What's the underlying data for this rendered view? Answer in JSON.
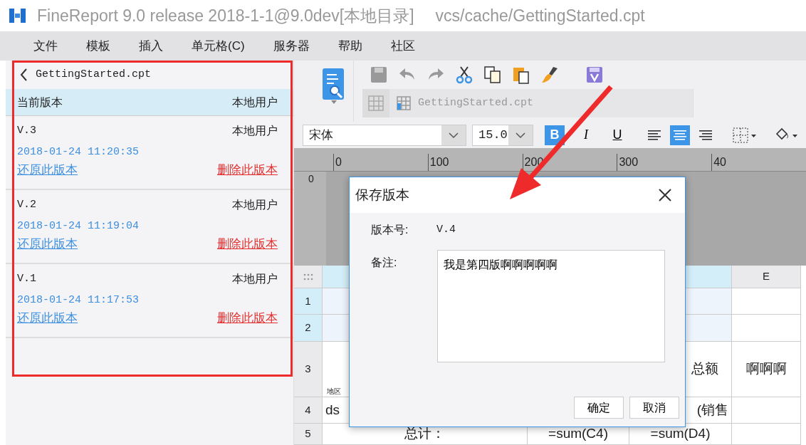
{
  "window": {
    "title": "FineReport 9.0 release 2018-1-1@9.0dev[本地目录]",
    "path": "vcs/cache/GettingStarted.cpt"
  },
  "menu": [
    "文件",
    "模板",
    "插入",
    "单元格(C)",
    "服务器",
    "帮助",
    "社区"
  ],
  "version_panel": {
    "file": "GettingStarted.cpt",
    "header": {
      "version": "当前版本",
      "user": "本地用户"
    },
    "versions": [
      {
        "version": "V.3",
        "user": "本地用户",
        "time": "2018-01-24 11:20:35",
        "restore": "还原此版本",
        "delete": "删除此版本"
      },
      {
        "version": "V.2",
        "user": "本地用户",
        "time": "2018-01-24 11:19:04",
        "restore": "还原此版本",
        "delete": "删除此版本"
      },
      {
        "version": "V.1",
        "user": "本地用户",
        "time": "2018-01-24 11:17:53",
        "restore": "还原此版本",
        "delete": "删除此版本"
      }
    ]
  },
  "toolbar": {
    "tab": "GettingStarted.cpt",
    "font": "宋体",
    "size": "15.0",
    "styles": [
      {
        "kind": "bold",
        "label": "B",
        "selected": true
      },
      {
        "kind": "italic",
        "label": "I",
        "selected": false
      },
      {
        "kind": "underline",
        "label": "U",
        "selected": false
      }
    ],
    "alignment": [
      {
        "kind": "left",
        "selected": false
      },
      {
        "kind": "center",
        "selected": true
      },
      {
        "kind": "right",
        "selected": false
      }
    ]
  },
  "ruler": {
    "ticks": [
      "0",
      "100",
      "200",
      "300",
      "40"
    ],
    "vertical": "0"
  },
  "sheet": {
    "column_header": "E",
    "rows": [
      {
        "label": "1",
        "selected": true,
        "cells": {}
      },
      {
        "label": "2",
        "selected": true,
        "cells": {}
      },
      {
        "label": "3",
        "selected": false,
        "cells": {
          "column_1": "地区",
          "column_4": "总额",
          "column_5": "啊啊啊"
        }
      },
      {
        "label": "4",
        "selected": false,
        "cells": {
          "column_1": "ds",
          "column_4": "(销售"
        }
      },
      {
        "label": "5",
        "selected": false,
        "cells": {
          "column_1": "总计：",
          "column_3": "=sum(C4)",
          "column_4": "=sum(D4)"
        }
      }
    ]
  },
  "dialog": {
    "title": "保存版本",
    "version_label": "版本号:",
    "version": "V.4",
    "note_label": "备注:",
    "note": "我是第四版啊啊啊啊啊",
    "buttons": [
      "确定",
      "取消"
    ]
  }
}
